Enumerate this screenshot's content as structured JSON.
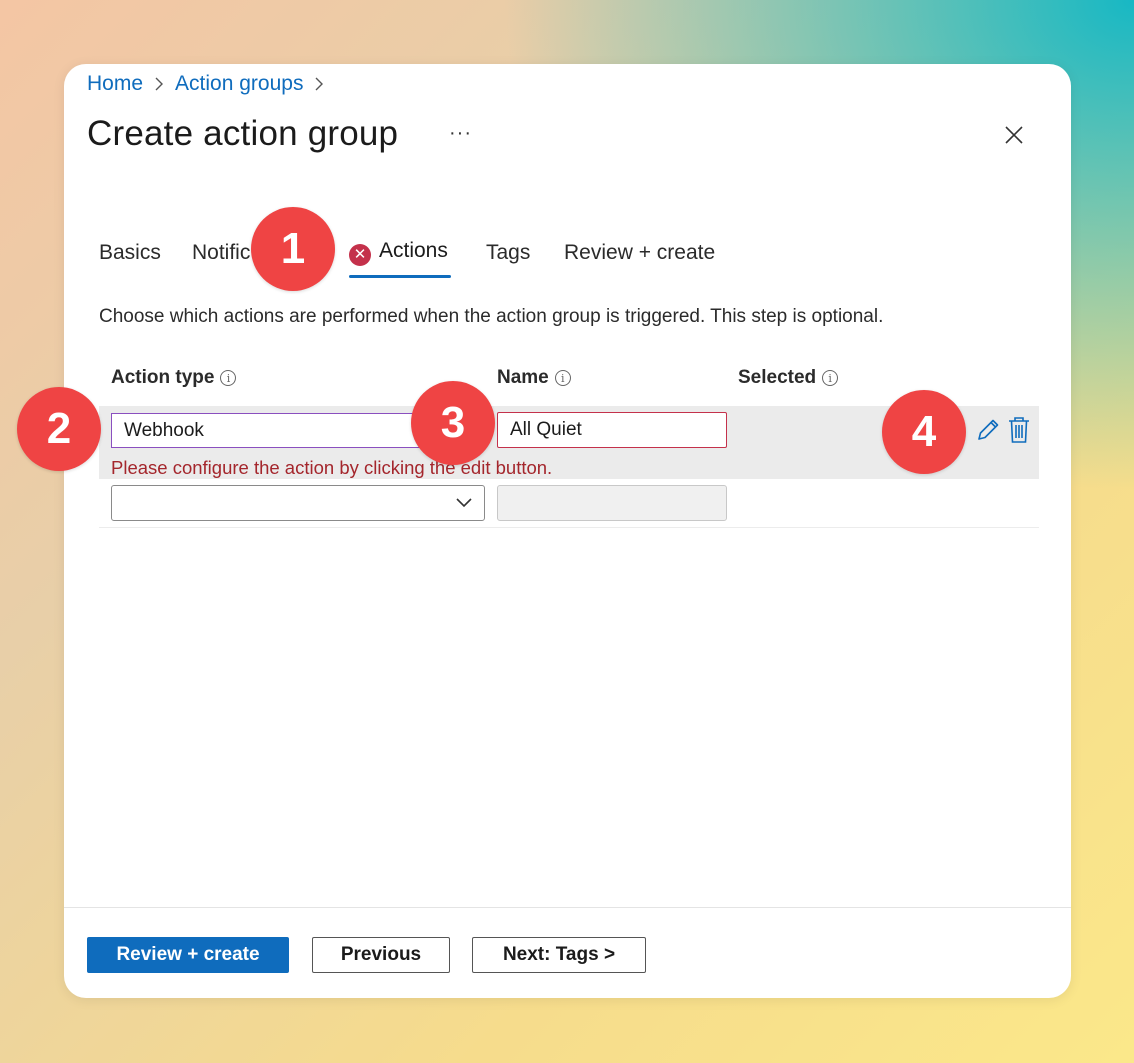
{
  "breadcrumb": {
    "home": "Home",
    "action_groups": "Action groups"
  },
  "page": {
    "title": "Create action group",
    "more_label": "···"
  },
  "tabs": [
    {
      "label": "Basics"
    },
    {
      "label": "Notific"
    },
    {
      "label": "Actions",
      "state": "error",
      "active": true
    },
    {
      "label": "Tags"
    },
    {
      "label": "Review + create"
    }
  ],
  "description": "Choose which actions are performed when the action group is triggered. This step is optional.",
  "table": {
    "headers": {
      "action_type": "Action type",
      "name": "Name",
      "selected": "Selected"
    },
    "rows": [
      {
        "action_type": "Webhook",
        "name": "All Quiet",
        "error": "Please configure the action by clicking the edit button."
      },
      {
        "action_type": "",
        "name": ""
      }
    ]
  },
  "footer": {
    "review_create": "Review + create",
    "previous": "Previous",
    "next": "Next: Tags >"
  },
  "badges": [
    "1",
    "2",
    "3",
    "4"
  ],
  "colors": {
    "accent": "#0f6cbd",
    "error": "#c4314b",
    "badge": "#ef4444"
  }
}
